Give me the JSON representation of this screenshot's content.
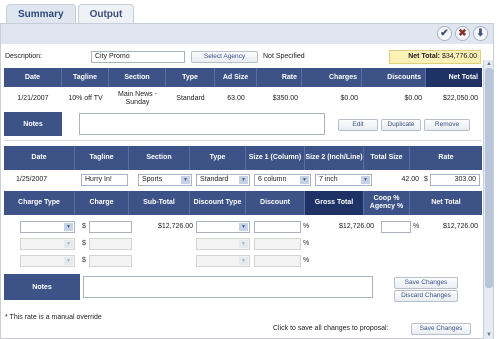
{
  "tabs": [
    {
      "label": "Summary"
    },
    {
      "label": "Output"
    }
  ],
  "toolbar": {
    "check_icon": "✔",
    "close_icon": "✖",
    "download_icon": "⬇"
  },
  "top": {
    "description_label": "Description:",
    "description_value": "City Promo",
    "select_agency_label": "Select Agency",
    "agency_value": "Not Specified",
    "net_total_label": "Net Total:",
    "net_total_value": "$34,776.00"
  },
  "summary_table": {
    "headers": [
      "Date",
      "Tagline",
      "Section",
      "Type",
      "Ad Size",
      "Rate",
      "Charges",
      "Discounts",
      "Net Total"
    ],
    "row": {
      "date": "1/21/2007",
      "tagline": "10% off TV",
      "section": "Main News - Sunday",
      "type": "Standard",
      "ad_size": "63.00",
      "rate": "$350.00",
      "charges": "$0.00",
      "discounts": "$0.00",
      "net_total": "$22,050.00"
    },
    "notes_label": "Notes",
    "edit_label": "Edit",
    "duplicate_label": "Duplicate",
    "remove_label": "Remove"
  },
  "edit_table": {
    "headers": [
      "Date",
      "Tagline",
      "Section",
      "Type",
      "Size 1 (Column)",
      "Size 2 (Inch/Line)",
      "Total Size",
      "Rate"
    ],
    "row": {
      "date": "1/25/2007",
      "tagline": "Hurry In!",
      "section": "Sports",
      "type": "Standard",
      "size1": "6 column",
      "size2": "7 inch",
      "total_size": "42.00",
      "rate_currency": "$",
      "rate": "303.00"
    }
  },
  "charge_table": {
    "headers": [
      "Charge Type",
      "Charge",
      "Sub-Total",
      "Discount Type",
      "Discount",
      "Gross Total",
      "Coop % Agency %",
      "Net Total"
    ],
    "currency_symbol": "$",
    "percent_symbol": "%",
    "sub_total": "$12,726.00",
    "gross_total": "$12,726.00",
    "net_total": "$12,726.00",
    "notes_label": "Notes",
    "save_changes_label": "Save Changes",
    "discard_changes_label": "Discard Changes"
  },
  "footer": {
    "manual_override_note": "* This rate is a manual override",
    "save_prompt": "Click to save all changes to proposal:",
    "save_changes_label": "Save Changes"
  },
  "colors": {
    "header_bg": "#3d5287",
    "net_total_bg": "#fbf0b5",
    "accent_text": "#355088"
  }
}
